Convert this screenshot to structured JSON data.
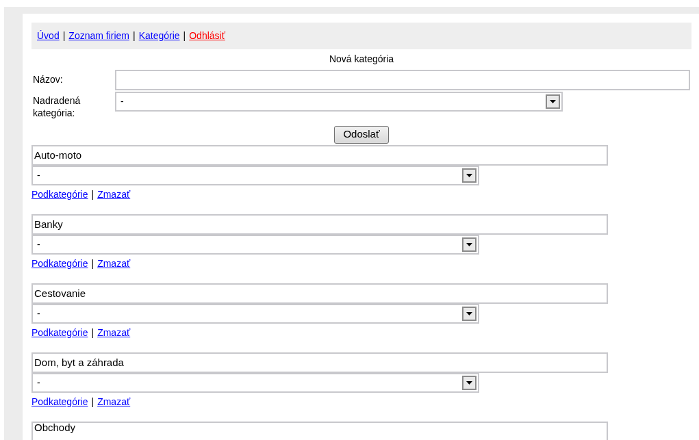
{
  "nav": [
    {
      "label": "Úvod",
      "kind": "link"
    },
    {
      "label": "Zoznam firiem",
      "kind": "link"
    },
    {
      "label": "Kategórie",
      "kind": "link"
    },
    {
      "label": "Odhlásiť",
      "kind": "logout"
    }
  ],
  "nav_separator": "|",
  "form": {
    "title": "Nová kategória",
    "name_label": "Názov:",
    "parent_label": "Nadradená kategória:",
    "parent_value": "-",
    "submit": "Odoslať"
  },
  "categories": [
    {
      "name": "Auto-moto",
      "parent": "-",
      "links": [
        "Podkategórie",
        "Zmazať"
      ]
    },
    {
      "name": "Banky",
      "parent": "-",
      "links": [
        "Podkategórie",
        "Zmazať"
      ]
    },
    {
      "name": "Cestovanie",
      "parent": "-",
      "links": [
        "Podkategórie",
        "Zmazať"
      ]
    },
    {
      "name": "Dom, byt a záhrada",
      "parent": "-",
      "links": [
        "Podkategórie",
        "Zmazať"
      ]
    },
    {
      "name": "Obchody"
    }
  ],
  "link_separator": "|"
}
